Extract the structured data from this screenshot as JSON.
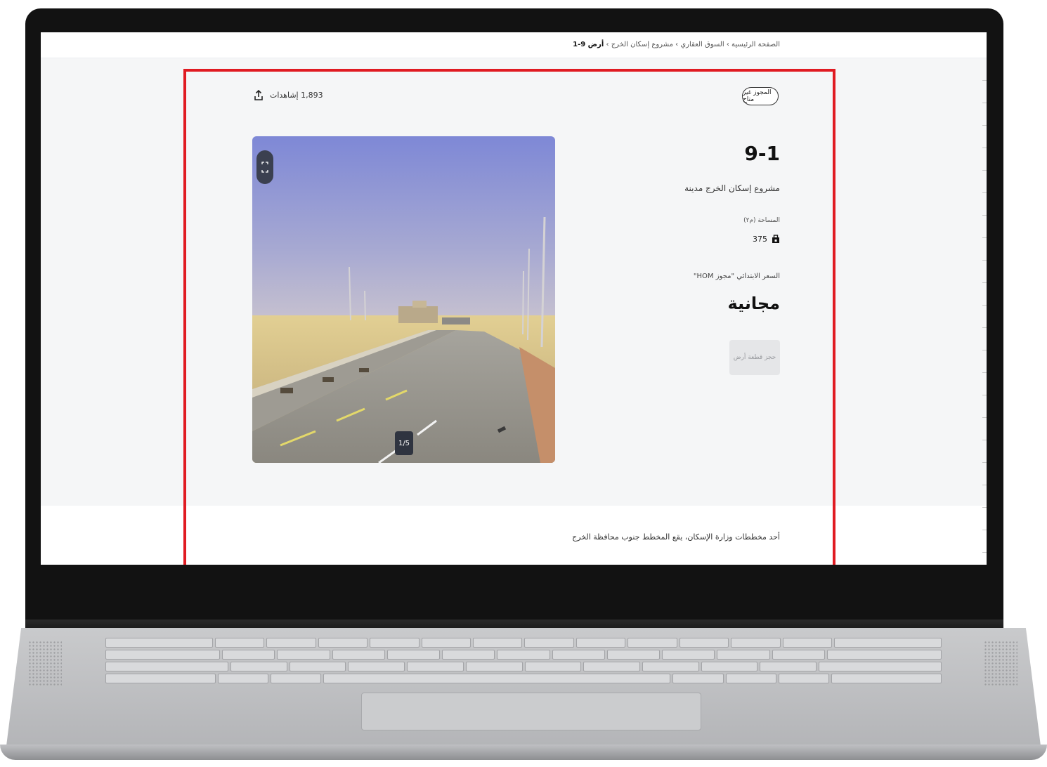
{
  "breadcrumb": {
    "items": [
      "الصفحة الرئيسية",
      "السوق العقاري",
      "مشروع إسكان الخرج"
    ],
    "current": "أرض 9-1",
    "separator": "›"
  },
  "header": {
    "tag_label": "المجوز غير متاح",
    "views": "1,893 إشاهدات"
  },
  "gallery": {
    "counter": "1/5",
    "expand_icon": "expand-icon"
  },
  "plot": {
    "title": "9-1",
    "project": "مشروع إسكان الخرج مدينة",
    "area_label": "المساحة (م٢)",
    "area_value": "375",
    "price_label": "السعر الابتدائي \"مجوز HOM\"",
    "price": "مجانية",
    "reserve_button": "حجز قطعة أرض"
  },
  "description": "أحد مخططات وزارة الإسكان، يقع المخطط جنوب محافظة الخرج",
  "colors": {
    "highlight": "#e01b22",
    "page_bg": "#f5f6f7"
  }
}
